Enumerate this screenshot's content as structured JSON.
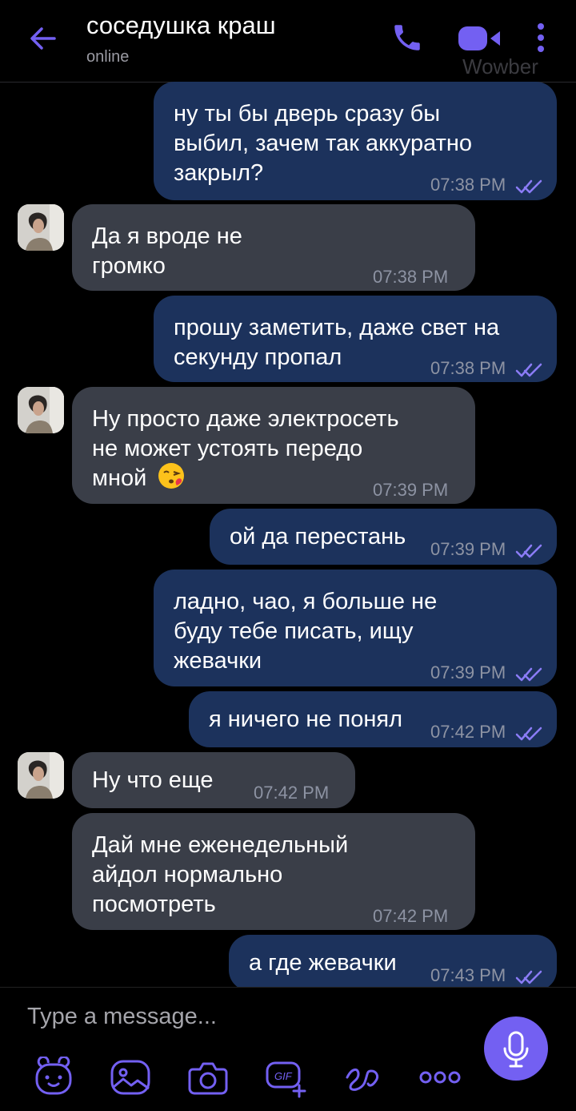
{
  "header": {
    "title": "соседушка краш",
    "status": "online",
    "watermark": "Wowber",
    "icons": [
      "arrow-left-icon",
      "phone-icon",
      "video-camera-icon",
      "more-vertical-icon"
    ]
  },
  "messages": [
    {
      "dir": "out",
      "text": "ну ты бы дверь сразу бы\nвыбил, зачем так аккуратно\nзакрыл?",
      "time": "07:38 PM",
      "read": true
    },
    {
      "dir": "in",
      "text": "Да я вроде не\nгромко",
      "time": "07:38 PM"
    },
    {
      "dir": "out",
      "text": "прошу заметить, даже свет на\nсекунду пропал",
      "time": "07:38 PM",
      "read": true
    },
    {
      "dir": "in",
      "text": "Ну просто даже электросеть\nне может устоять передо\nмной",
      "time": "07:39 PM",
      "emoji": "kissing-face-icon"
    },
    {
      "dir": "out",
      "text": "ой да перестань",
      "time": "07:39 PM",
      "read": true
    },
    {
      "dir": "out",
      "text": "ладно, чао, я больше не\nбуду тебе писать, ищу\nжевачки",
      "time": "07:39 PM",
      "read": true
    },
    {
      "dir": "out",
      "text": "я ничего не понял",
      "time": "07:42 PM",
      "read": true
    },
    {
      "dir": "in",
      "text": "Ну что еще",
      "time": "07:42 PM"
    },
    {
      "dir": "in",
      "text": "Дай мне еженедельный\nайдол нормально\nпосмотреть",
      "time": "07:42 PM"
    },
    {
      "dir": "out",
      "text": "а где жевачки",
      "time": "07:43 PM",
      "read": true
    }
  ],
  "composer": {
    "placeholder": "Type a message...",
    "tools": [
      "sticker-bear-icon",
      "gallery-icon",
      "camera-icon",
      "gif-icon",
      "doodle-icon",
      "more-horizontal-icon"
    ],
    "send": "microphone-icon",
    "gif_label": "GIF"
  },
  "colors": {
    "accent": "#7360f2",
    "outgoing": "#1c325c",
    "incoming": "#3a3e48",
    "read_ticks": "#8b7cf6"
  }
}
